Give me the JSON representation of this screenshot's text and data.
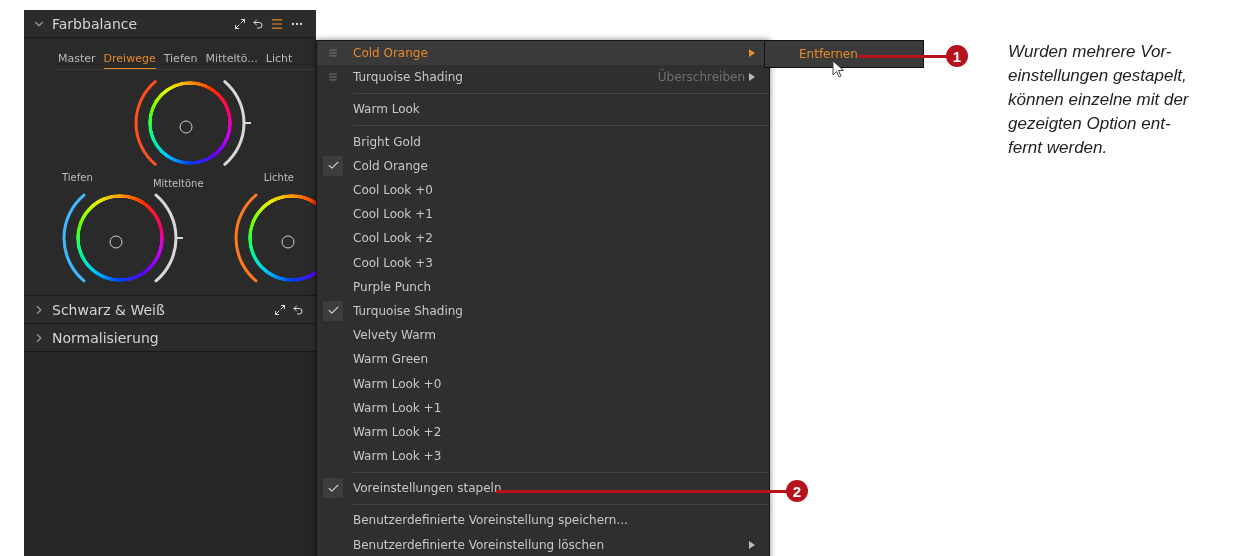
{
  "panel": {
    "sections": [
      {
        "title": "Farbbalance",
        "expanded": true,
        "tools": true
      },
      {
        "title": "Schwarz & Weiß",
        "expanded": false,
        "tools": true
      },
      {
        "title": "Normalisierung",
        "expanded": false,
        "tools": false
      }
    ],
    "tabs": [
      {
        "label": "Master",
        "selected": false
      },
      {
        "label": "Dreiwege",
        "selected": true
      },
      {
        "label": "Tiefen",
        "selected": false
      },
      {
        "label": "Mitteltö...",
        "selected": false
      },
      {
        "label": "Licht",
        "selected": false
      }
    ],
    "wheel_labels": [
      "Tiefen",
      "Mitteltöne",
      "Lichte"
    ]
  },
  "menu": {
    "items": [
      {
        "kind": "stacked",
        "label": "Cold Orange",
        "selected": true,
        "submenu": true
      },
      {
        "kind": "stacked",
        "label": "Turquoise Shading",
        "selected": false,
        "hint": "Überschreiben",
        "submenu": true
      },
      {
        "kind": "separator"
      },
      {
        "kind": "item",
        "label": "Warm Look",
        "checked": false,
        "submenu": false
      },
      {
        "kind": "separator"
      },
      {
        "kind": "item",
        "label": "Bright Gold",
        "checked": false,
        "submenu": false
      },
      {
        "kind": "item",
        "label": "Cold Orange",
        "checked": true,
        "submenu": false
      },
      {
        "kind": "item",
        "label": "Cool Look +0",
        "checked": false,
        "submenu": false
      },
      {
        "kind": "item",
        "label": "Cool Look +1",
        "checked": false,
        "submenu": false
      },
      {
        "kind": "item",
        "label": "Cool Look +2",
        "checked": false,
        "submenu": false
      },
      {
        "kind": "item",
        "label": "Cool Look +3",
        "checked": false,
        "submenu": false
      },
      {
        "kind": "item",
        "label": "Purple Punch",
        "checked": false,
        "submenu": false
      },
      {
        "kind": "item",
        "label": "Turquoise Shading",
        "checked": true,
        "submenu": false
      },
      {
        "kind": "item",
        "label": "Velvety Warm",
        "checked": false,
        "submenu": false
      },
      {
        "kind": "item",
        "label": "Warm Green",
        "checked": false,
        "submenu": false
      },
      {
        "kind": "item",
        "label": "Warm Look +0",
        "checked": false,
        "submenu": false
      },
      {
        "kind": "item",
        "label": "Warm Look +1",
        "checked": false,
        "submenu": false
      },
      {
        "kind": "item",
        "label": "Warm Look +2",
        "checked": false,
        "submenu": false
      },
      {
        "kind": "item",
        "label": "Warm Look +3",
        "checked": false,
        "submenu": false
      },
      {
        "kind": "separator"
      },
      {
        "kind": "item",
        "label": "Voreinstellungen stapeln",
        "checked": true,
        "submenu": false
      },
      {
        "kind": "separator"
      },
      {
        "kind": "item",
        "label": "Benutzerdefinierte Voreinstellung speichern...",
        "checked": false,
        "submenu": false
      },
      {
        "kind": "item",
        "label": "Benutzerdefinierte Voreinstellung löschen",
        "checked": false,
        "submenu": true
      }
    ]
  },
  "submenu": {
    "items": [
      {
        "label": "Entfernen",
        "selected": true
      }
    ]
  },
  "callouts": [
    {
      "number": "1"
    },
    {
      "number": "2"
    }
  ],
  "caption": {
    "lines": [
      "Wurden mehrere Vor-",
      "einstellungen gestapelt,",
      "können einzelne mit der",
      "gezeigten Option ent-",
      "fernt werden."
    ]
  }
}
